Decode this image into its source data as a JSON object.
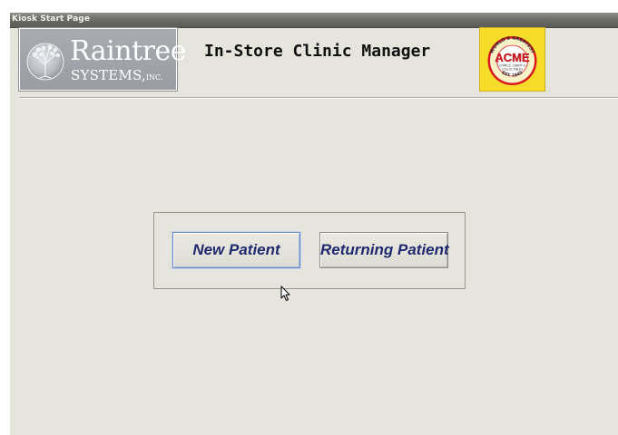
{
  "window": {
    "title": "Kiosk Start Page"
  },
  "header": {
    "raintree_logo": {
      "name": "Raintree",
      "subtitle": "SYSTEMS,",
      "suffix": "INC."
    },
    "app_title": "In-Store Clinic Manager",
    "acme_logo": {
      "brand": "ACME",
      "arc_top": "WORLD'S GREATEST",
      "line1": "COMICS, CANDY &",
      "line2": "COLLECTIBLES",
      "est": "EST. 1945"
    }
  },
  "actions": {
    "new_patient": "New Patient",
    "returning_patient": "Returning Patient"
  },
  "colors": {
    "background": "#e6e5dd",
    "titlebar": "#6e6e69",
    "button_text": "#1f2a6e",
    "acme_yellow": "#f7dc2a",
    "acme_red": "#d8191f"
  },
  "icons": {
    "raintree_emblem": "tree-globe-icon",
    "cursor": "mouse-pointer-icon"
  }
}
